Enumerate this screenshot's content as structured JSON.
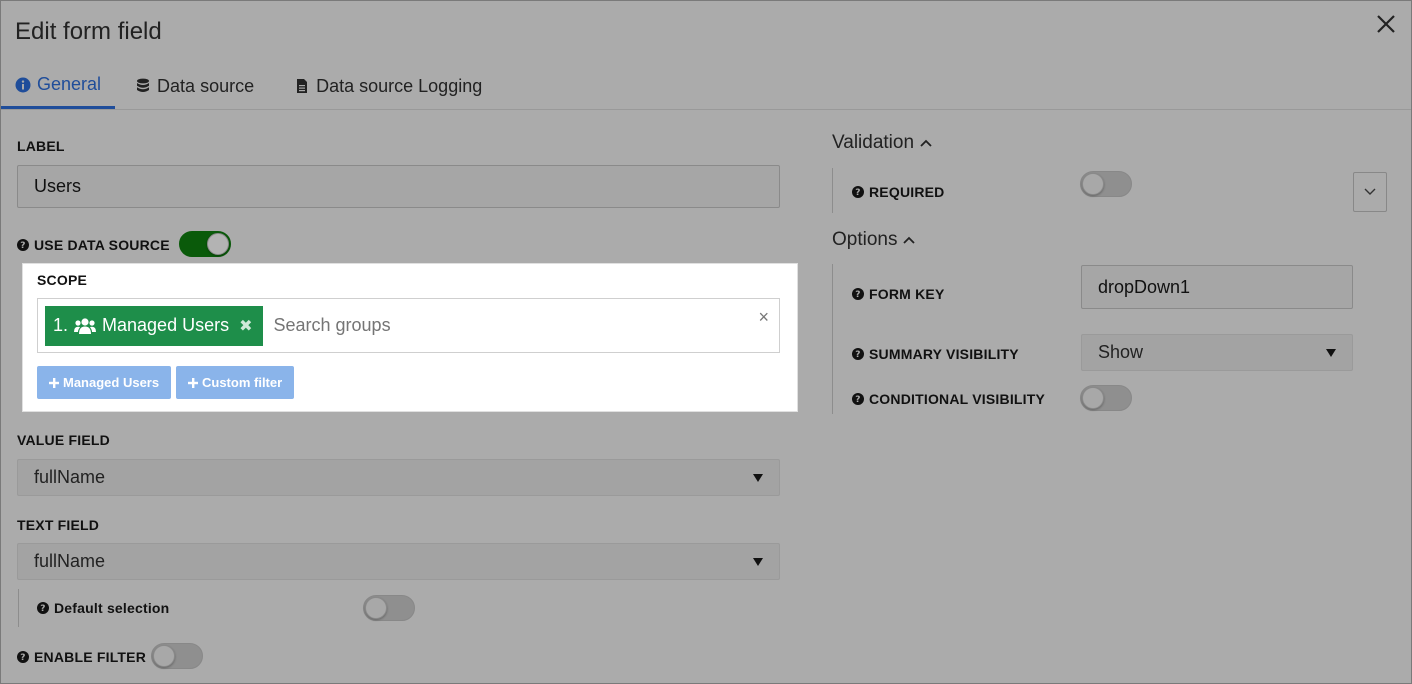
{
  "dialog": {
    "title": "Edit form field"
  },
  "tabs": [
    {
      "label": "General",
      "icon": "info-circle-icon",
      "active": true
    },
    {
      "label": "Data source",
      "icon": "database-icon",
      "active": false
    },
    {
      "label": "Data source Logging",
      "icon": "file-text-icon",
      "active": false
    }
  ],
  "left": {
    "label_caption": "LABEL",
    "label_value": "Users",
    "use_data_source": {
      "caption": "USE DATA SOURCE",
      "on": true
    },
    "scope": {
      "caption": "SCOPE",
      "chip_label": "1.",
      "chip_text": "Managed Users",
      "chip_remove": "✖",
      "search_placeholder": "Search groups",
      "clear": "×",
      "btn_managed": "Managed Users",
      "btn_custom": "Custom filter"
    },
    "value_field": {
      "caption": "VALUE FIELD",
      "selected": "fullName"
    },
    "text_field": {
      "caption": "TEXT FIELD",
      "selected": "fullName"
    },
    "default_selection": {
      "caption": "Default selection",
      "on": false
    },
    "enable_filter": {
      "caption": "ENABLE FILTER",
      "on": false
    }
  },
  "right": {
    "validation_head": "Validation",
    "required_caption": "REQUIRED",
    "options_head": "Options",
    "form_key_caption": "FORM KEY",
    "form_key_value": "dropDown1",
    "summary_visibility_caption": "SUMMARY VISIBILITY",
    "summary_visibility_selected": "Show",
    "conditional_visibility_caption": "CONDITIONAL VISIBILITY"
  },
  "colors": {
    "accent": "#1f4d9a",
    "chip": "#1e8e4a",
    "toggle_on": "#0a5a0a",
    "scope_btn": "#8ab4ea"
  }
}
